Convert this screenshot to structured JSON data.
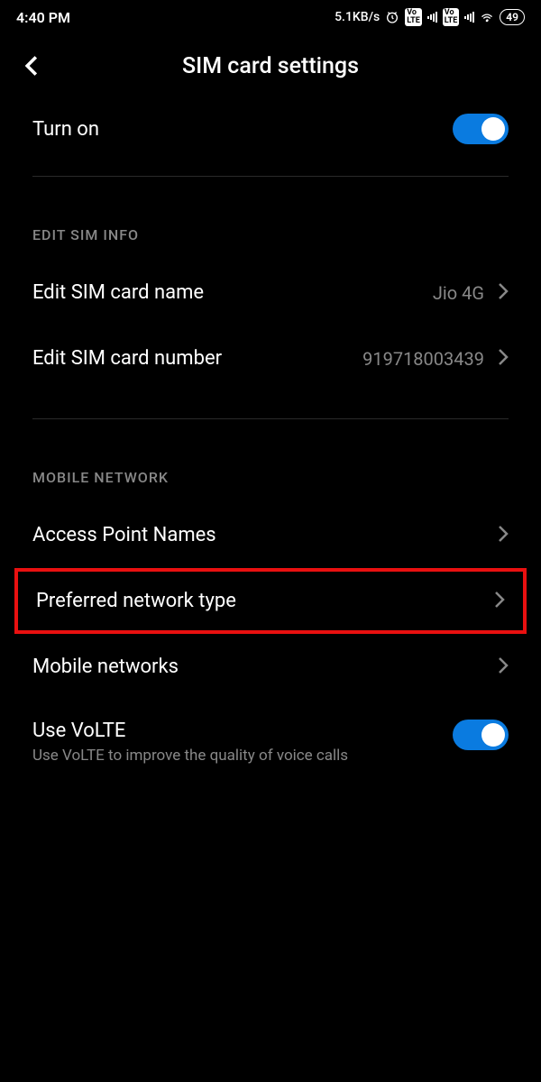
{
  "status": {
    "time": "4:40 PM",
    "speed": "5.1KB/s",
    "volte": "Vo LTE",
    "battery": "49"
  },
  "header": {
    "title": "SIM card settings"
  },
  "turn_on": {
    "label": "Turn on"
  },
  "sections": {
    "edit_sim": "EDIT SIM INFO",
    "mobile_network": "MOBILE NETWORK"
  },
  "sim_name": {
    "label": "Edit SIM card name",
    "value": "Jio 4G"
  },
  "sim_number": {
    "label": "Edit SIM card number",
    "value": "919718003439"
  },
  "apn": {
    "label": "Access Point Names"
  },
  "preferred_network": {
    "label": "Preferred network type"
  },
  "mobile_networks": {
    "label": "Mobile networks"
  },
  "volte": {
    "label": "Use VoLTE",
    "sub": "Use VoLTE to improve the quality of voice calls"
  }
}
